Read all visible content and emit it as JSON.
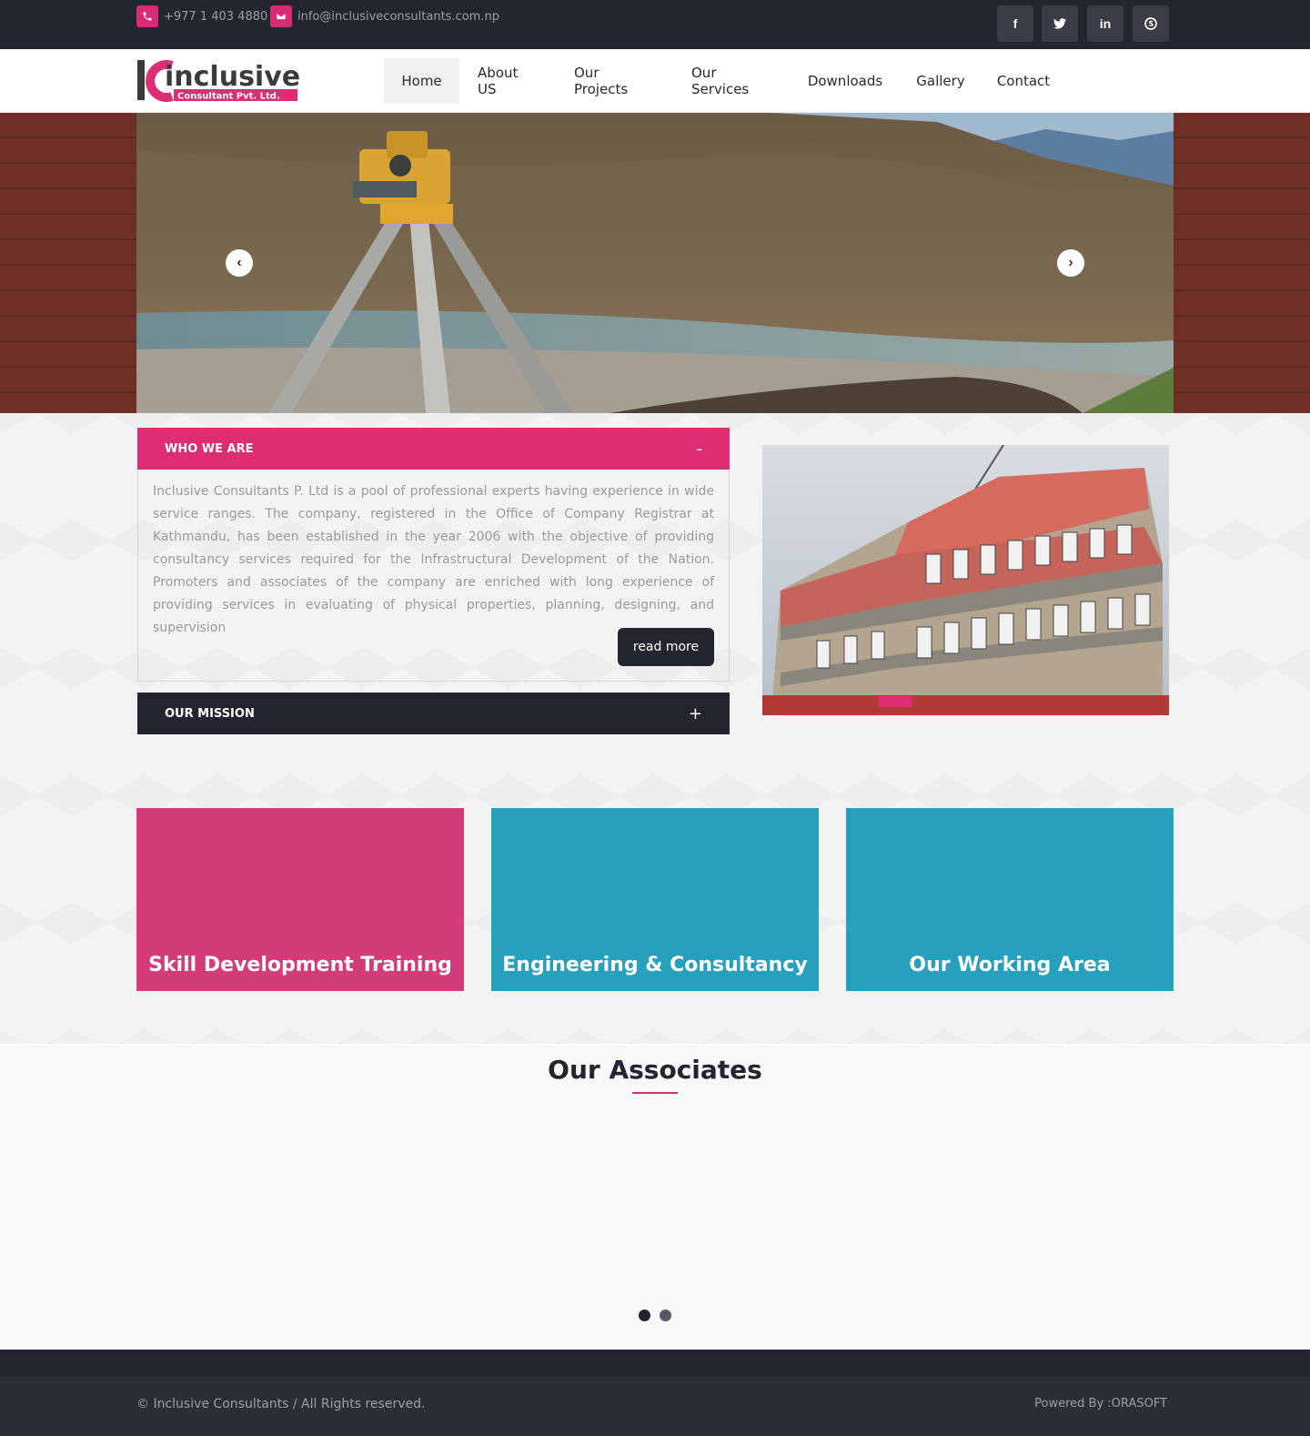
{
  "topbar": {
    "phone": "+977 1 403 4880",
    "email": "info@inclusiveconsultants.com.np",
    "phone_icon": "phone-icon",
    "email_icon": "envelope-icon",
    "social": [
      {
        "icon": "facebook-icon",
        "glyph": "f"
      },
      {
        "icon": "twitter-icon",
        "glyph": "t"
      },
      {
        "icon": "linkedin-icon",
        "glyph": "in"
      },
      {
        "icon": "skype-icon",
        "glyph": "S"
      }
    ]
  },
  "logo": {
    "brand": "inclusive",
    "tagline": "Consultant Pvt. Ltd."
  },
  "nav": {
    "items": [
      {
        "label": "Home",
        "active": true
      },
      {
        "label": "About US"
      },
      {
        "label": "Our Projects"
      },
      {
        "label": "Our Services"
      },
      {
        "label": "Downloads"
      },
      {
        "label": "Gallery"
      },
      {
        "label": "Contact"
      }
    ]
  },
  "hero": {
    "prev_arrow": "‹",
    "next_arrow": "›"
  },
  "who_we_are": {
    "title": "WHO WE ARE",
    "toggle": "-",
    "text": "Inclusive Consultants P. Ltd is a pool of professional experts having experience in wide service ranges. The company, registered in the Office of Company Registrar at Kathmandu, has been established in the year 2006 with the objective of providing consultancy services required for the Infrastructural Development of the Nation. Promoters and associates of the company are enriched with long experience of providing services in evaluating of physical properties, planning, designing, and supervision",
    "read_more": "read more"
  },
  "mission": {
    "title": "OUR MISSION",
    "toggle": "+"
  },
  "features": [
    {
      "label": "Skill Development Training",
      "color": "#d43b7a"
    },
    {
      "label": "Engineering & Consultancy",
      "color": "#27a0bd"
    },
    {
      "label": "Our Working Area",
      "color": "#27a0bd"
    }
  ],
  "associates": {
    "title": "Our Associates"
  },
  "footer": {
    "copyright": "© Inclusive Consultants / All Rights reserved.",
    "powered": "Powered By :ORASOFT"
  },
  "colors": {
    "accent": "#dc2d75",
    "dark": "#22252f",
    "teal": "#27a0bd"
  }
}
